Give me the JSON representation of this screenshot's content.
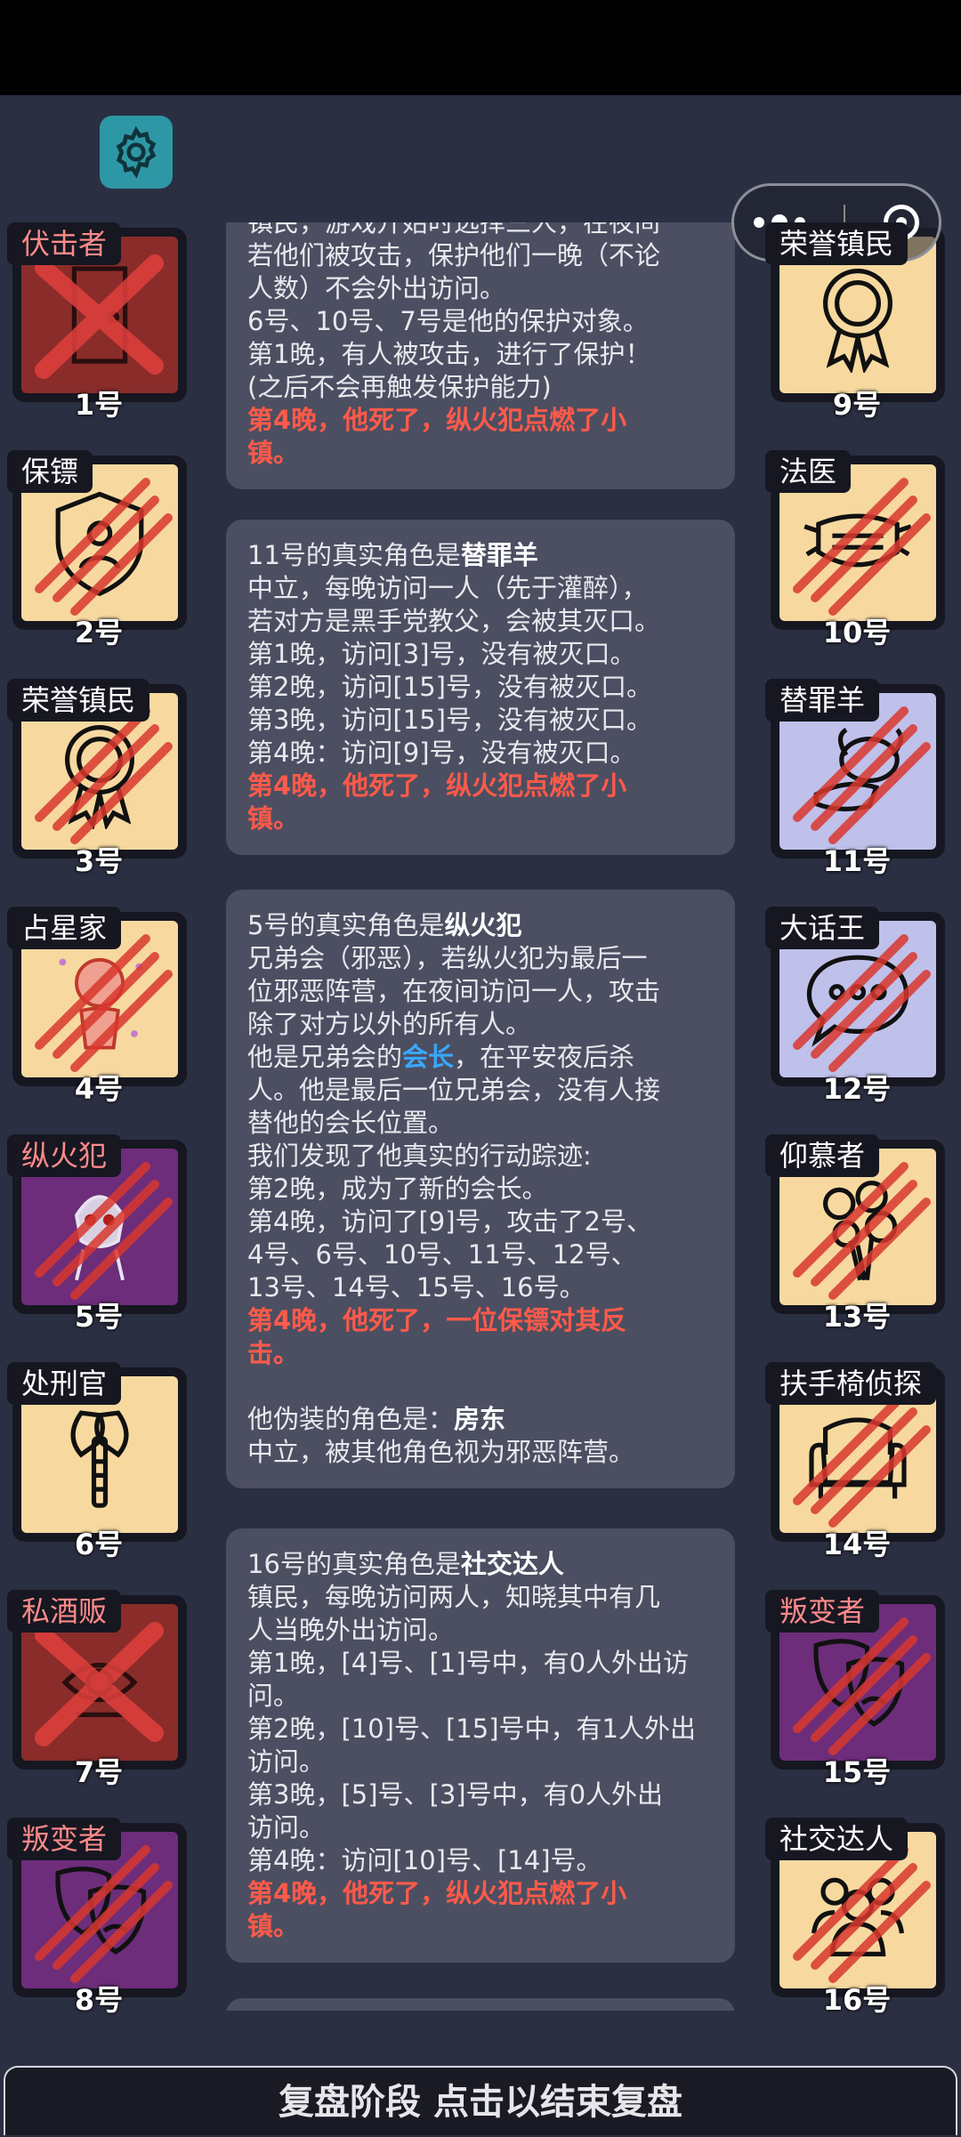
{
  "players": [
    {
      "number": "1号",
      "role": "伏击者",
      "faction": "dead",
      "dead": true
    },
    {
      "number": "2号",
      "role": "保镖",
      "faction": "town",
      "dead": false
    },
    {
      "number": "3号",
      "role": "荣誉镇民",
      "faction": "town",
      "dead": false
    },
    {
      "number": "4号",
      "role": "占星家",
      "faction": "town",
      "dead": false
    },
    {
      "number": "5号",
      "role": "纵火犯",
      "faction": "evil",
      "dead": false
    },
    {
      "number": "6号",
      "role": "处刑官",
      "faction": "town",
      "dead": false
    },
    {
      "number": "7号",
      "role": "私酒贩",
      "faction": "evil",
      "dead": true
    },
    {
      "number": "8号",
      "role": "叛变者",
      "faction": "evil",
      "dead": false
    },
    {
      "number": "9号",
      "role": "荣誉镇民",
      "faction": "town",
      "dead": false
    },
    {
      "number": "10号",
      "role": "法医",
      "faction": "town",
      "dead": false
    },
    {
      "number": "11号",
      "role": "替罪羊",
      "faction": "neutral",
      "dead": false
    },
    {
      "number": "12号",
      "role": "大话王",
      "faction": "neutral",
      "dead": false
    },
    {
      "number": "13号",
      "role": "仰慕者",
      "faction": "town",
      "dead": false
    },
    {
      "number": "14号",
      "role": "扶手椅侦探",
      "faction": "town",
      "dead": false
    },
    {
      "number": "15号",
      "role": "叛变者",
      "faction": "evil",
      "dead": false
    },
    {
      "number": "16号",
      "role": "社交达人",
      "faction": "town",
      "dead": false
    }
  ],
  "messages": {
    "m0": {
      "l1": "镇民，游戏开始时选择三人，在夜间",
      "l2": "若他们被攻击，保护他们一晚（不论",
      "l3": "人数）不会外出访问。",
      "l4": "6号、10号、7号是他的保护对象。",
      "l5": "第1晚，有人被攻击，进行了保护！",
      "l6": "(之后不会再触发保护能力)",
      "death1": "第4晚，他死了，纵火犯点燃了小",
      "death2": "镇。"
    },
    "m1": {
      "prefix": "11号的真实角色是",
      "role": "替罪羊",
      "l1": "中立，每晚访问一人（先于灌醉），",
      "l2": "若对方是黑手党教父，会被其灭口。",
      "l3": "第1晚，访问[3]号，没有被灭口。",
      "l4": "第2晚，访问[15]号，没有被灭口。",
      "l5": "第3晚，访问[15]号，没有被灭口。",
      "l6": "第4晚：访问[9]号，没有被灭口。",
      "death1": "第4晚，他死了，纵火犯点燃了小",
      "death2": "镇。"
    },
    "m2": {
      "prefix": "5号的真实角色是",
      "role": "纵火犯",
      "l1": "兄弟会（邪恶），若纵火犯为最后一",
      "l2": "位邪恶阵营，在夜间访问一人，攻击",
      "l3": "除了对方以外的所有人。",
      "l4a": "他是兄弟会的",
      "l4b": "会长",
      "l4c": "，在平安夜后杀",
      "l5": "人。他是最后一位兄弟会，没有人接",
      "l6": "替他的会长位置。",
      "l7": "我们发现了他真实的行动踪迹:",
      "l8": "第2晚，成为了新的会长。",
      "l9": "第4晚，访问了[9]号，攻击了2号、",
      "l10": "4号、6号、10号、11号、12号、",
      "l11": "13号、14号、15号、16号。",
      "death1": "第4晚，他死了，一位保镖对其反",
      "death2": "击。",
      "disguise_prefix": "他伪装的角色是：",
      "disguise": "房东",
      "l12": "中立，被其他角色视为邪恶阵营。"
    },
    "m3": {
      "prefix": "16号的真实角色是",
      "role": "社交达人",
      "l1": "镇民，每晚访问两人，知晓其中有几",
      "l2": "人当晚外出访问。",
      "l3": "第1晚，[4]号、[1]号中，有0人外出访",
      "l4": "问。",
      "l5": "第2晚，[10]号、[15]号中，有1人外出",
      "l6": "访问。",
      "l7": "第3晚，[5]号、[3]号中，有0人外出",
      "l8": "访问。",
      "l9": "第4晚：访问[10]号、[14]号。",
      "death1": "第4晚，他死了，纵火犯点燃了小",
      "death2": "镇。"
    }
  },
  "bottom": {
    "label": "复盘阶段 点击以结束复盘"
  },
  "colors": {
    "death_text": "#ff5a4a",
    "highlight": "#39a8ff",
    "evil_label": "#ff8a8a"
  }
}
